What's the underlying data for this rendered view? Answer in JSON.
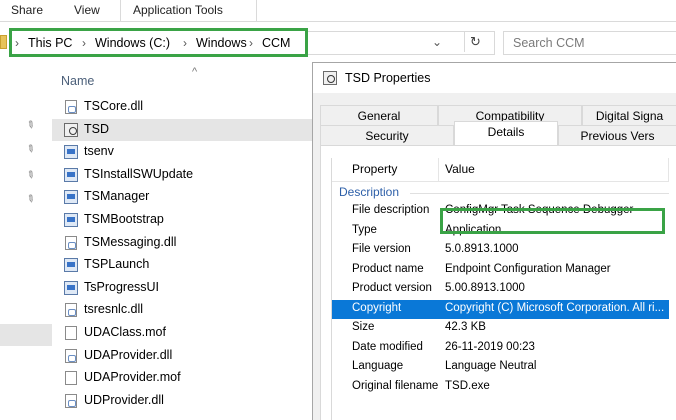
{
  "ribbon": {
    "tabs": [
      "Share",
      "View",
      "Application Tools"
    ]
  },
  "address_bar": {
    "segments": [
      "This PC",
      "Windows (C:)",
      "Windows",
      "CCM"
    ],
    "highlight_color": "#3aa346"
  },
  "search": {
    "placeholder": "Search CCM"
  },
  "file_list": {
    "column_header": "Name",
    "files": [
      {
        "name": "TSCore.dll",
        "icon": "dll-file-icon"
      },
      {
        "name": "TSD",
        "icon": "tsd-app-icon",
        "selected": true
      },
      {
        "name": "tsenv",
        "icon": "app-icon"
      },
      {
        "name": "TSInstallSWUpdate",
        "icon": "app-icon"
      },
      {
        "name": "TSManager",
        "icon": "app-icon"
      },
      {
        "name": "TSMBootstrap",
        "icon": "app-icon"
      },
      {
        "name": "TSMessaging.dll",
        "icon": "dll-file-icon"
      },
      {
        "name": "TSPLaunch",
        "icon": "app-icon"
      },
      {
        "name": "TsProgressUI",
        "icon": "app-icon"
      },
      {
        "name": "tsresnlc.dll",
        "icon": "dll-file-icon"
      },
      {
        "name": "UDAClass.mof",
        "icon": "file-icon"
      },
      {
        "name": "UDAProvider.dll",
        "icon": "dll-file-icon"
      },
      {
        "name": "UDAProvider.mof",
        "icon": "file-icon"
      },
      {
        "name": "UDProvider.dll",
        "icon": "dll-file-icon"
      }
    ]
  },
  "properties_dialog": {
    "title": "TSD Properties",
    "tabs_row1": [
      "General",
      "Compatibility",
      "Digital Signa"
    ],
    "tabs_row2": [
      "Security",
      "Details",
      "Previous Vers"
    ],
    "active_tab": "Details",
    "columns": [
      "Property",
      "Value"
    ],
    "section": "Description",
    "properties": [
      {
        "key": "File description",
        "value": "ConfigMgr Task Sequence Debugger"
      },
      {
        "key": "Type",
        "value": "Application"
      },
      {
        "key": "File version",
        "value": "5.0.8913.1000"
      },
      {
        "key": "Product name",
        "value": "Endpoint Configuration Manager"
      },
      {
        "key": "Product version",
        "value": "5.00.8913.1000"
      },
      {
        "key": "Copyright",
        "value": "Copyright (C) Microsoft Corporation. All ri...",
        "selected": true
      },
      {
        "key": "Size",
        "value": "42.3 KB"
      },
      {
        "key": "Date modified",
        "value": "26-11-2019 00:23"
      },
      {
        "key": "Language",
        "value": "Language Neutral"
      },
      {
        "key": "Original filename",
        "value": "TSD.exe"
      }
    ]
  }
}
